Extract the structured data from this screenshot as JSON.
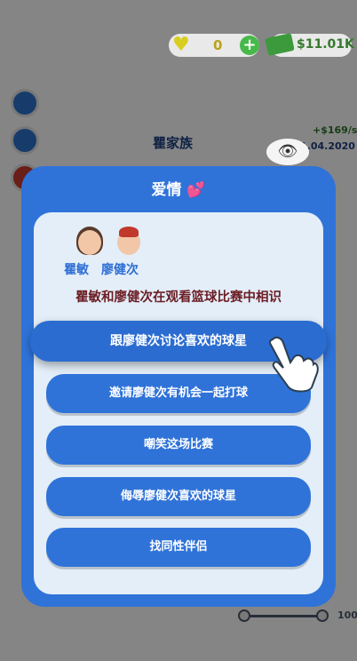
{
  "status_bar": {
    "hearts": "0",
    "cash": "$11.01K"
  },
  "background": {
    "family_title": "瞿家族",
    "income_rate": "+$169/s",
    "date": "1.04.2020",
    "slider_value": "100",
    "slider_level": 0.98
  },
  "modal": {
    "title": "爱情",
    "characters": [
      {
        "name": "瞿敏"
      },
      {
        "name": "廖健次"
      }
    ],
    "scene_text": "瞿敏和廖健次在观看篮球比赛中相识",
    "options": [
      {
        "label": "跟廖健次讨论喜欢的球星",
        "selected": true
      },
      {
        "label": "邀请廖健次有机会一起打球",
        "selected": false
      },
      {
        "label": "嘲笑这场比赛",
        "selected": false
      },
      {
        "label": "侮辱廖健次喜欢的球星",
        "selected": false
      },
      {
        "label": "找同性伴侣",
        "selected": false
      }
    ]
  },
  "colors": {
    "modal_blue": "#2f73d9",
    "panel_bg": "#e3eef8",
    "scene_text": "#6b1d24",
    "name_blue": "#2f6ed4"
  }
}
